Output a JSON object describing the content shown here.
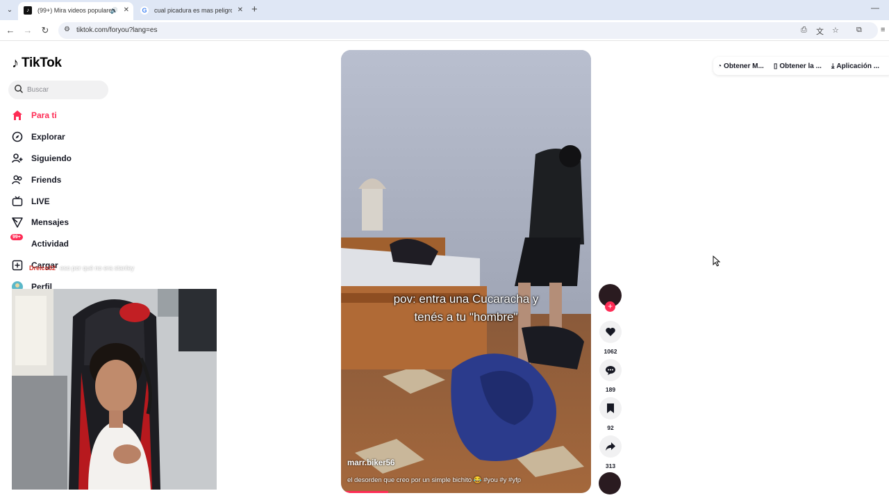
{
  "browser": {
    "tabs": [
      {
        "title": "(99+) Mira videos populares",
        "active": true,
        "favicon": "tiktok-icon",
        "audio": true
      },
      {
        "title": "cual picadura es mas peligrosa",
        "active": false,
        "favicon": "google-icon"
      }
    ],
    "url": "tiktok.com/foryou?lang=es"
  },
  "brand": {
    "name": "TikTok",
    "accent": "#fe2c55"
  },
  "search": {
    "placeholder": "Buscar"
  },
  "nav": {
    "items": [
      {
        "label": "Para ti",
        "icon": "home-icon",
        "active": true
      },
      {
        "label": "Explorar",
        "icon": "compass-icon"
      },
      {
        "label": "Siguiendo",
        "icon": "add-user-icon"
      },
      {
        "label": "Friends",
        "icon": "friends-icon"
      },
      {
        "label": "LIVE",
        "icon": "live-icon"
      },
      {
        "label": "Mensajes",
        "icon": "send-icon"
      },
      {
        "label": "Actividad",
        "icon": "bell-icon",
        "badge": "99+"
      },
      {
        "label": "Cargar",
        "icon": "upload-icon"
      },
      {
        "label": "Perfil",
        "icon": "profile-avatar"
      }
    ]
  },
  "chat_overlay": {
    "user": "Drelco32",
    "message": "eso por qué no era stanley"
  },
  "video": {
    "caption_lines": [
      "pov: entra una Cucaracha y",
      "tenés a tu \"hombre\""
    ],
    "author": "marr.biker56",
    "description": "el desorden que creo por un simple bichito 😂 #you #y #yfp",
    "progress": 0.19
  },
  "actions": {
    "likes": "1062",
    "comments": "189",
    "saves": "92",
    "shares": "313"
  },
  "topbar": {
    "items": [
      {
        "label": "Obtener M...",
        "icon": "coin-icon"
      },
      {
        "label": "Obtener la ...",
        "icon": "phone-icon"
      },
      {
        "label": "Aplicación ...",
        "icon": "download-icon"
      }
    ]
  }
}
